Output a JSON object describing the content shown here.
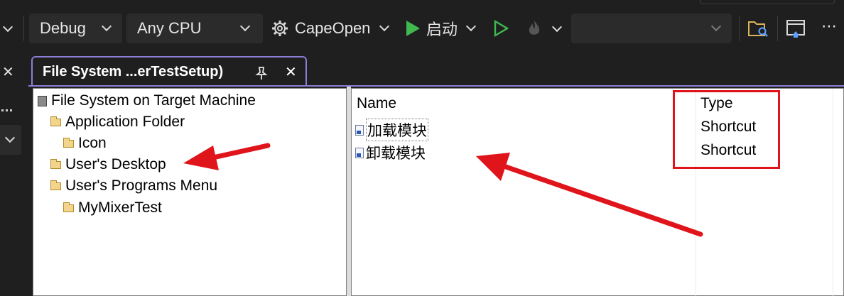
{
  "toolbar": {
    "config": "Debug",
    "platform": "Any CPU",
    "project": "CapeOpen",
    "start_label": "启动",
    "more": "⋯",
    "colors": {
      "play": "#3fb950",
      "bg": "#1f1f1f",
      "dropdown": "#2b2b2b"
    }
  },
  "left_strip": {
    "close": "✕"
  },
  "tab": {
    "title": "File System ...erTestSetup)",
    "pin": "📌",
    "close": "✕"
  },
  "tree": {
    "root": "File System on Target Machine",
    "items": [
      {
        "label": "Application Folder"
      },
      {
        "label": "Icon"
      },
      {
        "label": "User's Desktop"
      },
      {
        "label": "User's Programs Menu"
      },
      {
        "label": "MyMixerTest"
      }
    ]
  },
  "list": {
    "headers": {
      "name": "Name",
      "type": "Type"
    },
    "rows": [
      {
        "name": "加载模块",
        "type": "Shortcut"
      },
      {
        "name": "卸载模块",
        "type": "Shortcut"
      }
    ]
  },
  "annotation_color": "#e0141b"
}
